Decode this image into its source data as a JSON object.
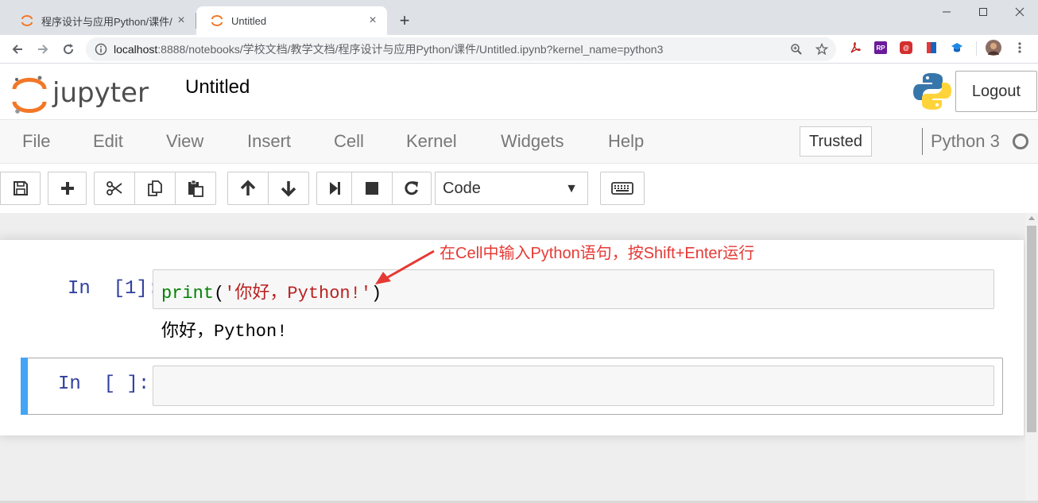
{
  "browser": {
    "tabs": [
      {
        "title": "程序设计与应用Python/课件/",
        "active": false
      },
      {
        "title": "Untitled",
        "active": true
      }
    ],
    "new_tab": "+",
    "url_host": "localhost",
    "url_rest": ":8888/notebooks/学校文档/教学文档/程序设计与应用Python/课件/Untitled.ipynb?kernel_name=python3",
    "extensions": [
      {
        "name": "pdf-extension-icon",
        "color": "#b71c1c",
        "label": ""
      },
      {
        "name": "rp-extension-icon",
        "color": "#6a1b9a",
        "label": "RP"
      },
      {
        "name": "red-extension-icon",
        "color": "#d32f2f",
        "label": "@"
      },
      {
        "name": "bookmark-extension-icon",
        "color": "#1565c0",
        "label": ""
      },
      {
        "name": "grad-cap-extension-icon",
        "color": "#1e88e5",
        "label": ""
      }
    ]
  },
  "jupyter": {
    "notebook_title": "Untitled",
    "logout_label": "Logout",
    "menu": [
      "File",
      "Edit",
      "View",
      "Insert",
      "Cell",
      "Kernel",
      "Widgets",
      "Help"
    ],
    "trusted_label": "Trusted",
    "kernel_name": "Python 3",
    "cell_type": "Code"
  },
  "cells": [
    {
      "prompt": "In  [1]:",
      "code_fn": "print",
      "code_open": "(",
      "code_str": "'你好，Python!'",
      "code_close": ")",
      "output": "你好，Python!"
    },
    {
      "prompt": "In  [ ]:",
      "code": ""
    }
  ],
  "annotation": "在Cell中输入Python语句，按Shift+Enter运行",
  "colors": {
    "accent_blue": "#42a5f5",
    "prompt_blue": "#303f9f",
    "annotation_red": "#e53935",
    "jupyter_orange": "#f37726"
  }
}
